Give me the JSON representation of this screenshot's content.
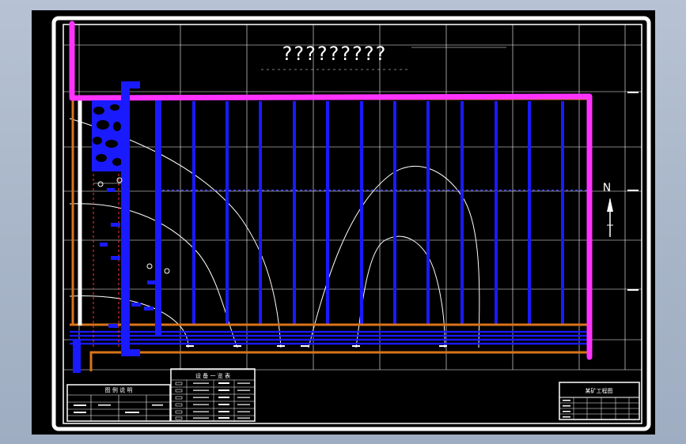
{
  "drawing": {
    "title": "?????????",
    "north_label": "N",
    "legend_left_title": "图 例 说 明",
    "legend_mid_title": "设 备 一 览 表",
    "title_block_label": "某矿工程图"
  },
  "colors": {
    "background": "#000000",
    "frame": "#ffffff",
    "pipe_magenta": "#ff33ff",
    "pipe_orange": "#d9741a",
    "well_blue": "#1a1aff",
    "line_white": "#ffffff"
  }
}
